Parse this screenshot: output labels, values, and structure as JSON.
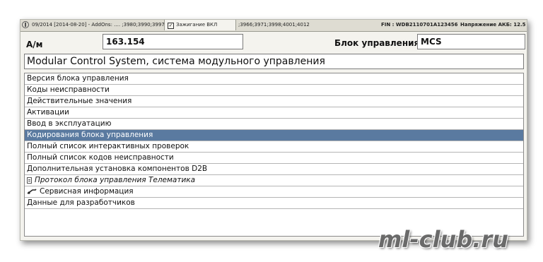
{
  "status_strip": {
    "left_text": "09/2014 [2014-08-20] - AddOns: .... ;3980;3990;3997;",
    "ignition_tab": {
      "checked": true,
      "label": "Зажигание ВКЛ"
    },
    "middle_text": ";3966;3971;3998;4001;4012",
    "fin_text": "FIN : WDB2110701A123456",
    "voltage_text": "Напряжение АКБ: 12.5"
  },
  "header": {
    "am_label": "А/м",
    "am_value": "163.154",
    "control_unit_label": "Блок управления",
    "control_unit_value": "MCS"
  },
  "system_title": "Modular Control System, система модульного управления",
  "menu_items": [
    {
      "label": "Версия блока управления",
      "selected": false,
      "icon": null,
      "italic": false
    },
    {
      "label": "Коды неисправности",
      "selected": false,
      "icon": null,
      "italic": false
    },
    {
      "label": "Действительные значения",
      "selected": false,
      "icon": null,
      "italic": false
    },
    {
      "label": "Активации",
      "selected": false,
      "icon": null,
      "italic": false
    },
    {
      "label": "Ввод в эксплуатацию",
      "selected": false,
      "icon": null,
      "italic": false
    },
    {
      "label": "Кодирования блока управления",
      "selected": true,
      "icon": null,
      "italic": false
    },
    {
      "label": "Полный список интерактивных проверок",
      "selected": false,
      "icon": null,
      "italic": false
    },
    {
      "label": "Полный список кодов неисправности",
      "selected": false,
      "icon": null,
      "italic": false
    },
    {
      "label": "Дополнительная установка компонентов D2B",
      "selected": false,
      "icon": null,
      "italic": false
    },
    {
      "label": "Протокол блока управления Телематика",
      "selected": false,
      "icon": "document-icon",
      "italic": true
    },
    {
      "label": "Сервисная информация",
      "selected": false,
      "icon": "service-wrench-icon",
      "italic": false
    },
    {
      "label": "Данные для разработчиков",
      "selected": false,
      "icon": null,
      "italic": false
    }
  ],
  "watermark": "ml-club.ru",
  "colors": {
    "selection": "#5a7aa0",
    "frame": "#f4f3ee"
  }
}
